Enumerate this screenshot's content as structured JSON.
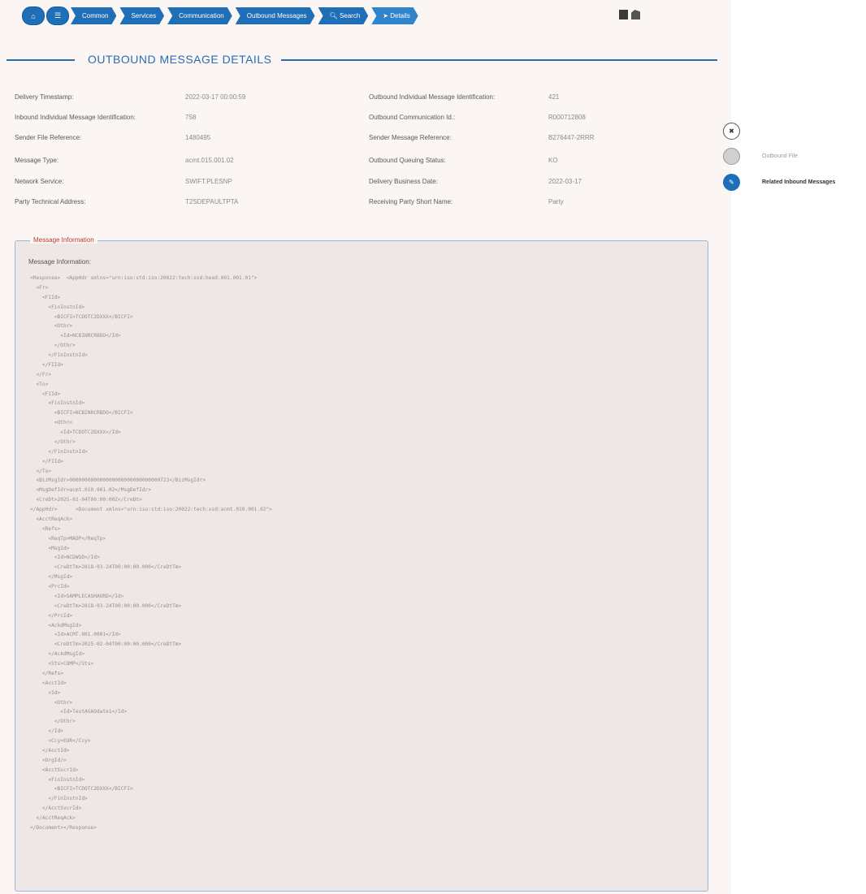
{
  "breadcrumb": {
    "home_icon": "home-icon",
    "menu_icon": "menu-icon",
    "items": [
      "Common",
      "Services",
      "Communication",
      "Outbound Messages",
      "Search",
      "Details"
    ]
  },
  "title": "OUTBOUND MESSAGE DETAILS",
  "details": {
    "left": [
      {
        "label": "Delivery Timestamp:",
        "value": "2022-03-17 00:00:59"
      },
      {
        "label": "Inbound Individual Message Identification:",
        "value": "758"
      },
      {
        "label": "Sender File Reference:",
        "value": "1480495"
      },
      {
        "label": "Message Type:",
        "value": "acmt.015.001.02"
      },
      {
        "label": "Network Service:",
        "value": "SWIFT.PLESNP"
      },
      {
        "label": "Party Technical Address:",
        "value": "T2SDEPAULTPTA"
      }
    ],
    "right": [
      {
        "label": "Outbound Individual Message Identification:",
        "value": "421"
      },
      {
        "label": "Outbound Communication Id.:",
        "value": "R000712808"
      },
      {
        "label": "Sender Message Reference:",
        "value": "B276447-2RRR"
      },
      {
        "label": "Outbound Queuing Status:",
        "value": "KO"
      },
      {
        "label": "Delivery Business Date:",
        "value": "2022-03-17"
      },
      {
        "label": "Receiving Party Short Name:",
        "value": "Party"
      }
    ]
  },
  "actions": [
    {
      "icon": "close-icon",
      "label": ""
    },
    {
      "icon": "file-icon",
      "label": "Outbound File"
    },
    {
      "icon": "edit-icon",
      "label": "Related Inbound Messages"
    }
  ],
  "message_box": {
    "legend": "Message Information",
    "sublabel": "Message Information:",
    "xml": "<Response>  <AppHdr xmlns=\"urn:iso:std:iso:20022:tech:xsd:head.001.001.01\">\n  <Fr>\n    <FIId>\n      <FinInstnId>\n        <BICFI>TCDOTC2DXXX</BICFI>\n        <Othr>\n          <Id>NCBINRCRBDO</Id>\n        </Othr>\n      </FinInstnId>\n    </FIId>\n  </Fr>\n  <To>\n    <FIId>\n      <FinInstnId>\n        <BICFI>NCBINRCRBDO</BICFI>\n        <Othr>\n          <Id>TCDOTC2DXXX</Id>\n        </Othr>\n      </FinInstnId>\n    </FIId>\n  </To>\n  <BizMsgIdr>000000000000000000000000000000723</BizMsgIdr>\n  <MsgDefIdr>acmt.010.001.02</MsgDefIdr>\n  <CreDt>2025-02-04T00:00:00Z</CreDt>\n</AppHdr>      <Document xmlns=\"urn:iso:std:iso:20022:tech:xsd:acmt.010.001.02\">\n  <AcctReqAck>\n    <Refs>\n      <ReqTp>MAOP</ReqTp>\n      <MsgId>\n        <Id>NCDWSD</Id>\n        <CreDtTm>2018-03-24T00:00:00.000</CreDtTm>\n      </MsgId>\n      <PrcId>\n        <Id>SAMPLECASHAURD</Id>\n        <CreDtTm>2018-03-24T00:00:00.000</CreDtTm>\n      </PrcId>\n      <AckdMsgId>\n        <Id>ACMT.001.0001</Id>\n        <CreDtTm>2025-02-04T00:00:00.000</CreDtTm>\n      </AckdMsgId>\n      <Sts>COMP</Sts>\n    </Refs>\n    <AcctId>\n      <Id>\n        <Othr>\n          <Id>TestAGAOdate1</Id>\n        </Othr>\n      </Id>\n      <Ccy>EUR</Ccy>\n    </AcctId>\n    <OrgId/>\n    <AcctSvcrId>\n      <FinInstnId>\n        <BICFI>TCDOTC2DXXX</BICFI>\n      </FinInstnId>\n    </AcctSvcrId>\n  </AcctReqAck>\n</Document></Response>"
  }
}
